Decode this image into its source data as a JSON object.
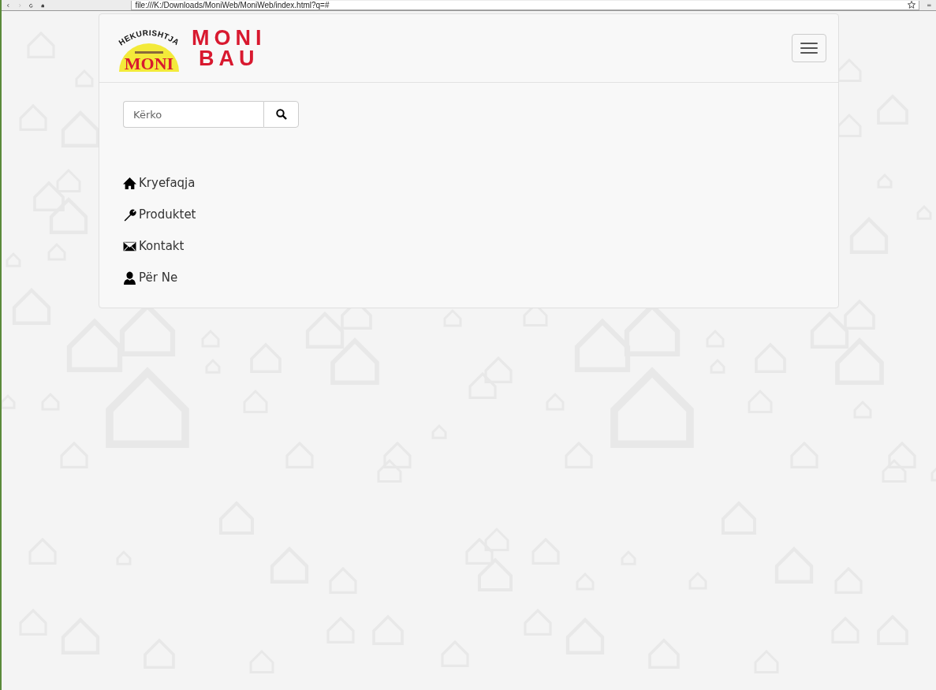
{
  "browser": {
    "address": "file:///K:/Downloads/MoniWeb/MoniWeb/index.html?q=#"
  },
  "logo": {
    "arc_text": "HEKURISHTJA",
    "badge_text": "MONI",
    "title_lines": [
      "MONI",
      "BAU"
    ]
  },
  "search": {
    "placeholder": "Kërko"
  },
  "nav": [
    {
      "kind": "home",
      "label": "Kryefaqja"
    },
    {
      "kind": "wrench",
      "label": "Produktet"
    },
    {
      "kind": "envelope",
      "label": "Kontakt"
    },
    {
      "kind": "user",
      "label": "Për Ne"
    }
  ]
}
